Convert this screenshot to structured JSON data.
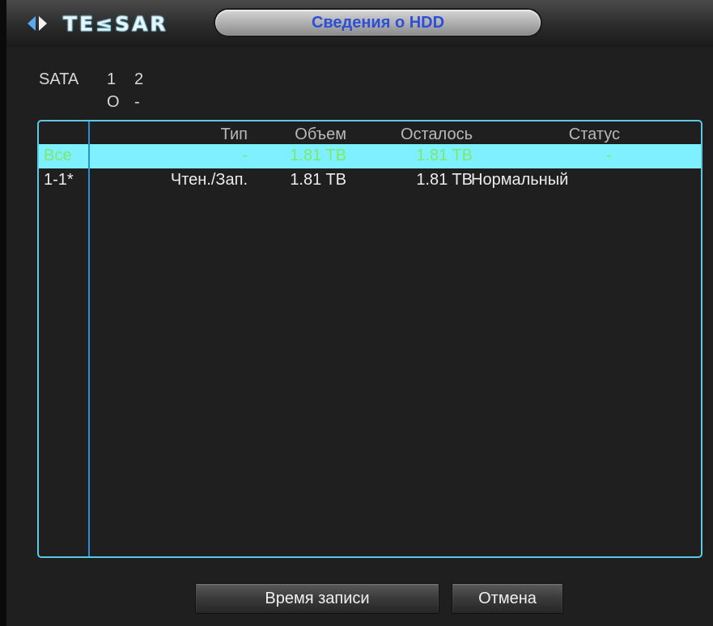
{
  "window": {
    "title": "Сведения о HDD",
    "logo_text": "TE≤SAR",
    "logo_icon": "diamond-arrows-icon"
  },
  "sata": {
    "label": "SATA",
    "ports": [
      "1",
      "2"
    ],
    "states": [
      "O",
      "-"
    ]
  },
  "table": {
    "headers": {
      "type": "Тип",
      "volume": "Объем",
      "remaining": "Осталось",
      "status": "Статус"
    },
    "rows": [
      {
        "id": "Все",
        "type": "-",
        "volume": "1.81 TB",
        "remaining": "1.81 TB",
        "status": "-",
        "selected": true
      },
      {
        "id": "1-1*",
        "type": "Чтен./Зап.",
        "volume": "1.81 TB",
        "remaining": "1.81 TB",
        "status": "Нормальный",
        "selected": false
      }
    ]
  },
  "buttons": {
    "record_time": "Время записи",
    "cancel": "Отмена"
  },
  "colors": {
    "title_text": "#2b4fd8",
    "selected_row_bg": "#7ff0ff",
    "selected_row_text": "#7de86a",
    "frame_border": "#5ec8e4"
  }
}
